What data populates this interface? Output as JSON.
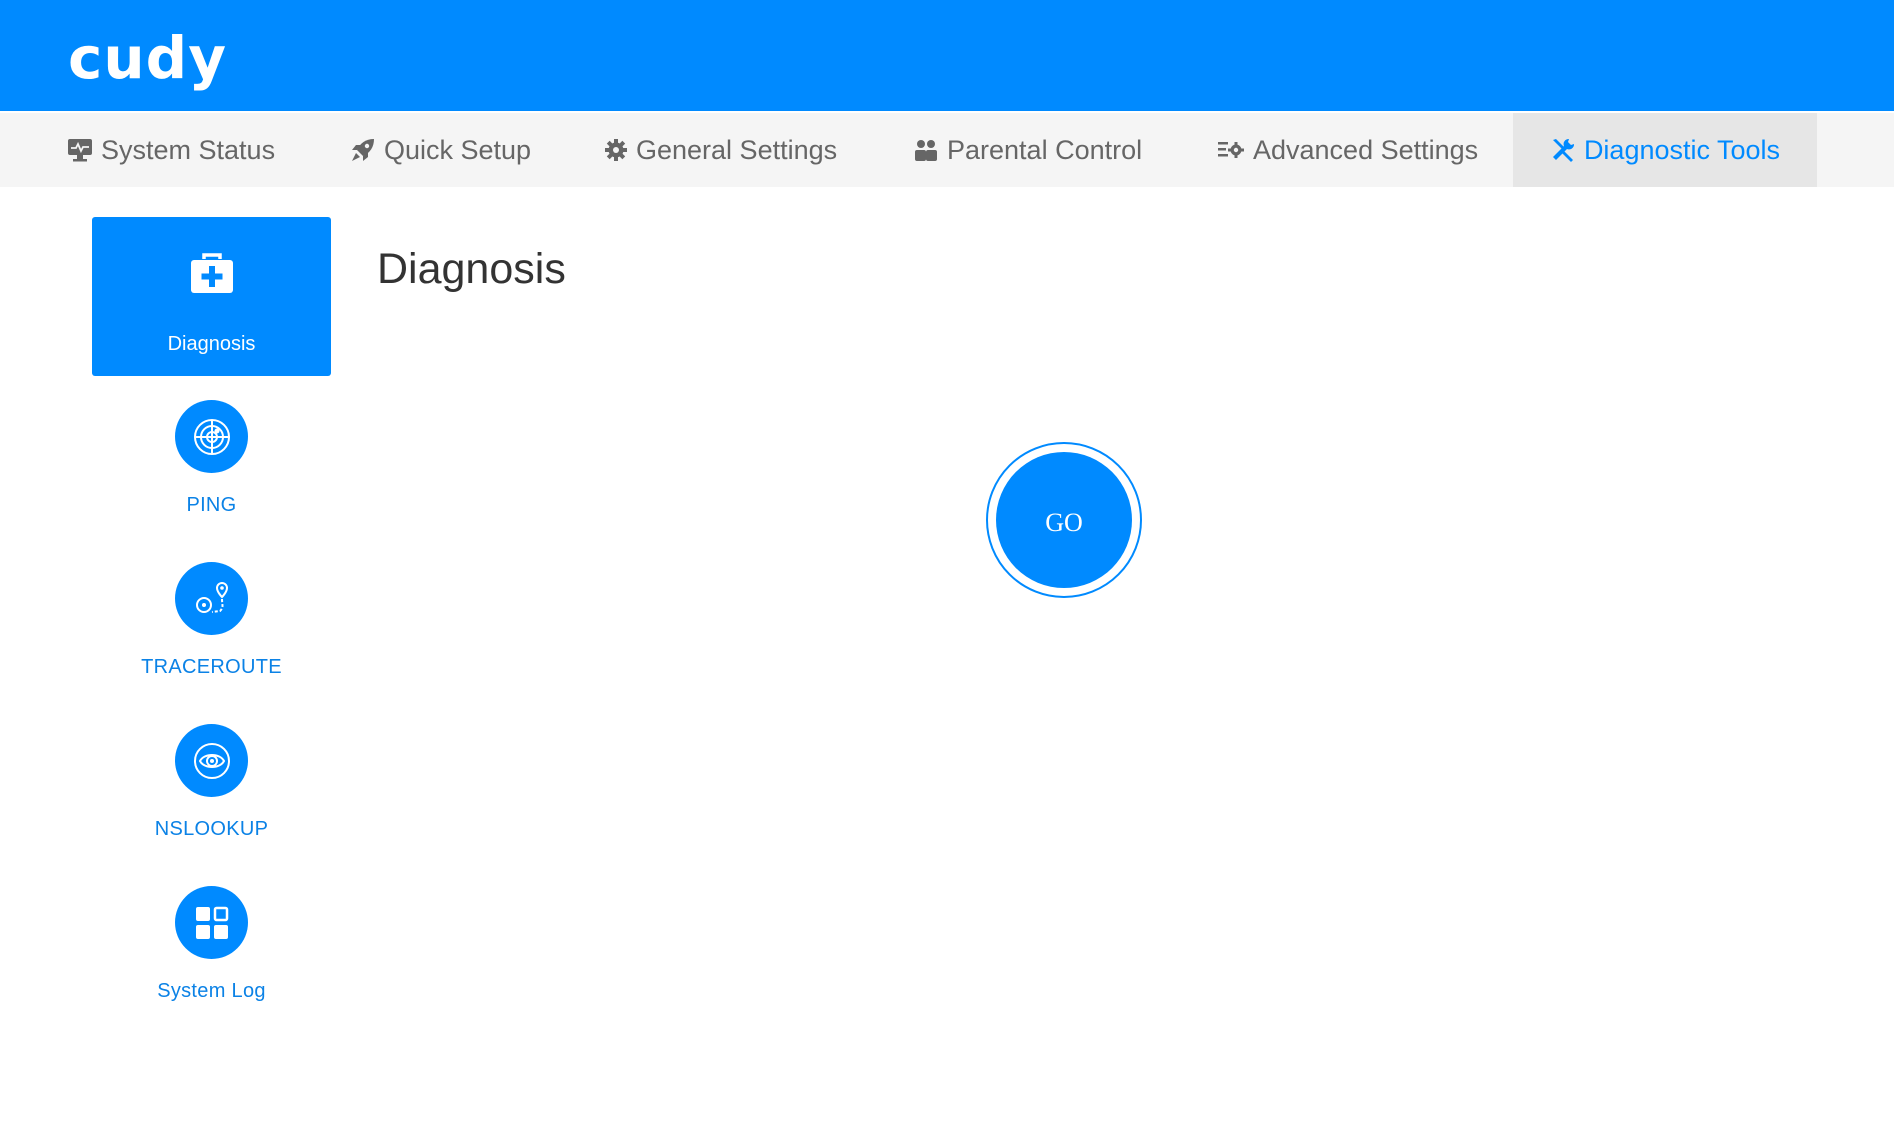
{
  "brand": {
    "logo_text": "cudy",
    "color": "#008aff"
  },
  "nav": {
    "items": [
      {
        "label": "System Status",
        "icon": "monitor-icon",
        "active": false
      },
      {
        "label": "Quick Setup",
        "icon": "rocket-icon",
        "active": false
      },
      {
        "label": "General Settings",
        "icon": "gear-icon",
        "active": false
      },
      {
        "label": "Parental Control",
        "icon": "users-icon",
        "active": false
      },
      {
        "label": "Advanced Settings",
        "icon": "sliders-gear-icon",
        "active": false
      },
      {
        "label": "Diagnostic Tools",
        "icon": "wrench-screwdriver-icon",
        "active": true
      }
    ]
  },
  "sidebar": {
    "items": [
      {
        "label": "Diagnosis",
        "icon": "medkit-icon",
        "active": true
      },
      {
        "label": "PING",
        "icon": "radar-icon",
        "active": false
      },
      {
        "label": "TRACEROUTE",
        "icon": "route-pin-icon",
        "active": false
      },
      {
        "label": "NSLOOKUP",
        "icon": "eye-target-icon",
        "active": false
      },
      {
        "label": "System Log",
        "icon": "grid-icon",
        "active": false
      }
    ]
  },
  "main": {
    "title": "Diagnosis",
    "go_label": "GO"
  },
  "colors": {
    "accent": "#008aff",
    "nav_bg": "#f5f5f5",
    "nav_active_bg": "#e6e6e6",
    "nav_text": "#666666"
  }
}
